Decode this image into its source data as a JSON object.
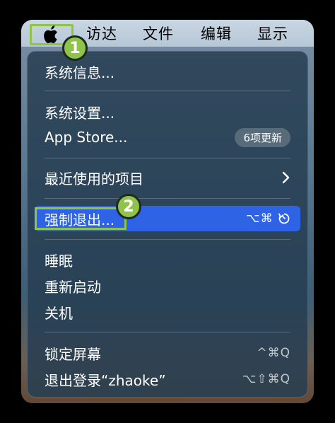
{
  "menubar": {
    "items": [
      "访达",
      "文件",
      "编辑",
      "显示"
    ]
  },
  "callouts": [
    "1",
    "2"
  ],
  "menu": {
    "about": "系统信息...",
    "settings": "系统设置...",
    "app_store": "App Store...",
    "app_store_badge": "6项更新",
    "recent_items": "最近使用的项目",
    "force_quit": "强制退出...",
    "force_quit_shortcut": "⌥⌘",
    "sleep": "睡眠",
    "restart": "重新启动",
    "shutdown": "关机",
    "lock_screen": "锁定屏幕",
    "lock_screen_shortcut": "^⌘Q",
    "logout": "退出登录“zhaoke”",
    "logout_shortcut": "⌥⇧⌘Q"
  },
  "colors": {
    "highlight": "#2e63e6",
    "callout": "#8fc44a"
  }
}
